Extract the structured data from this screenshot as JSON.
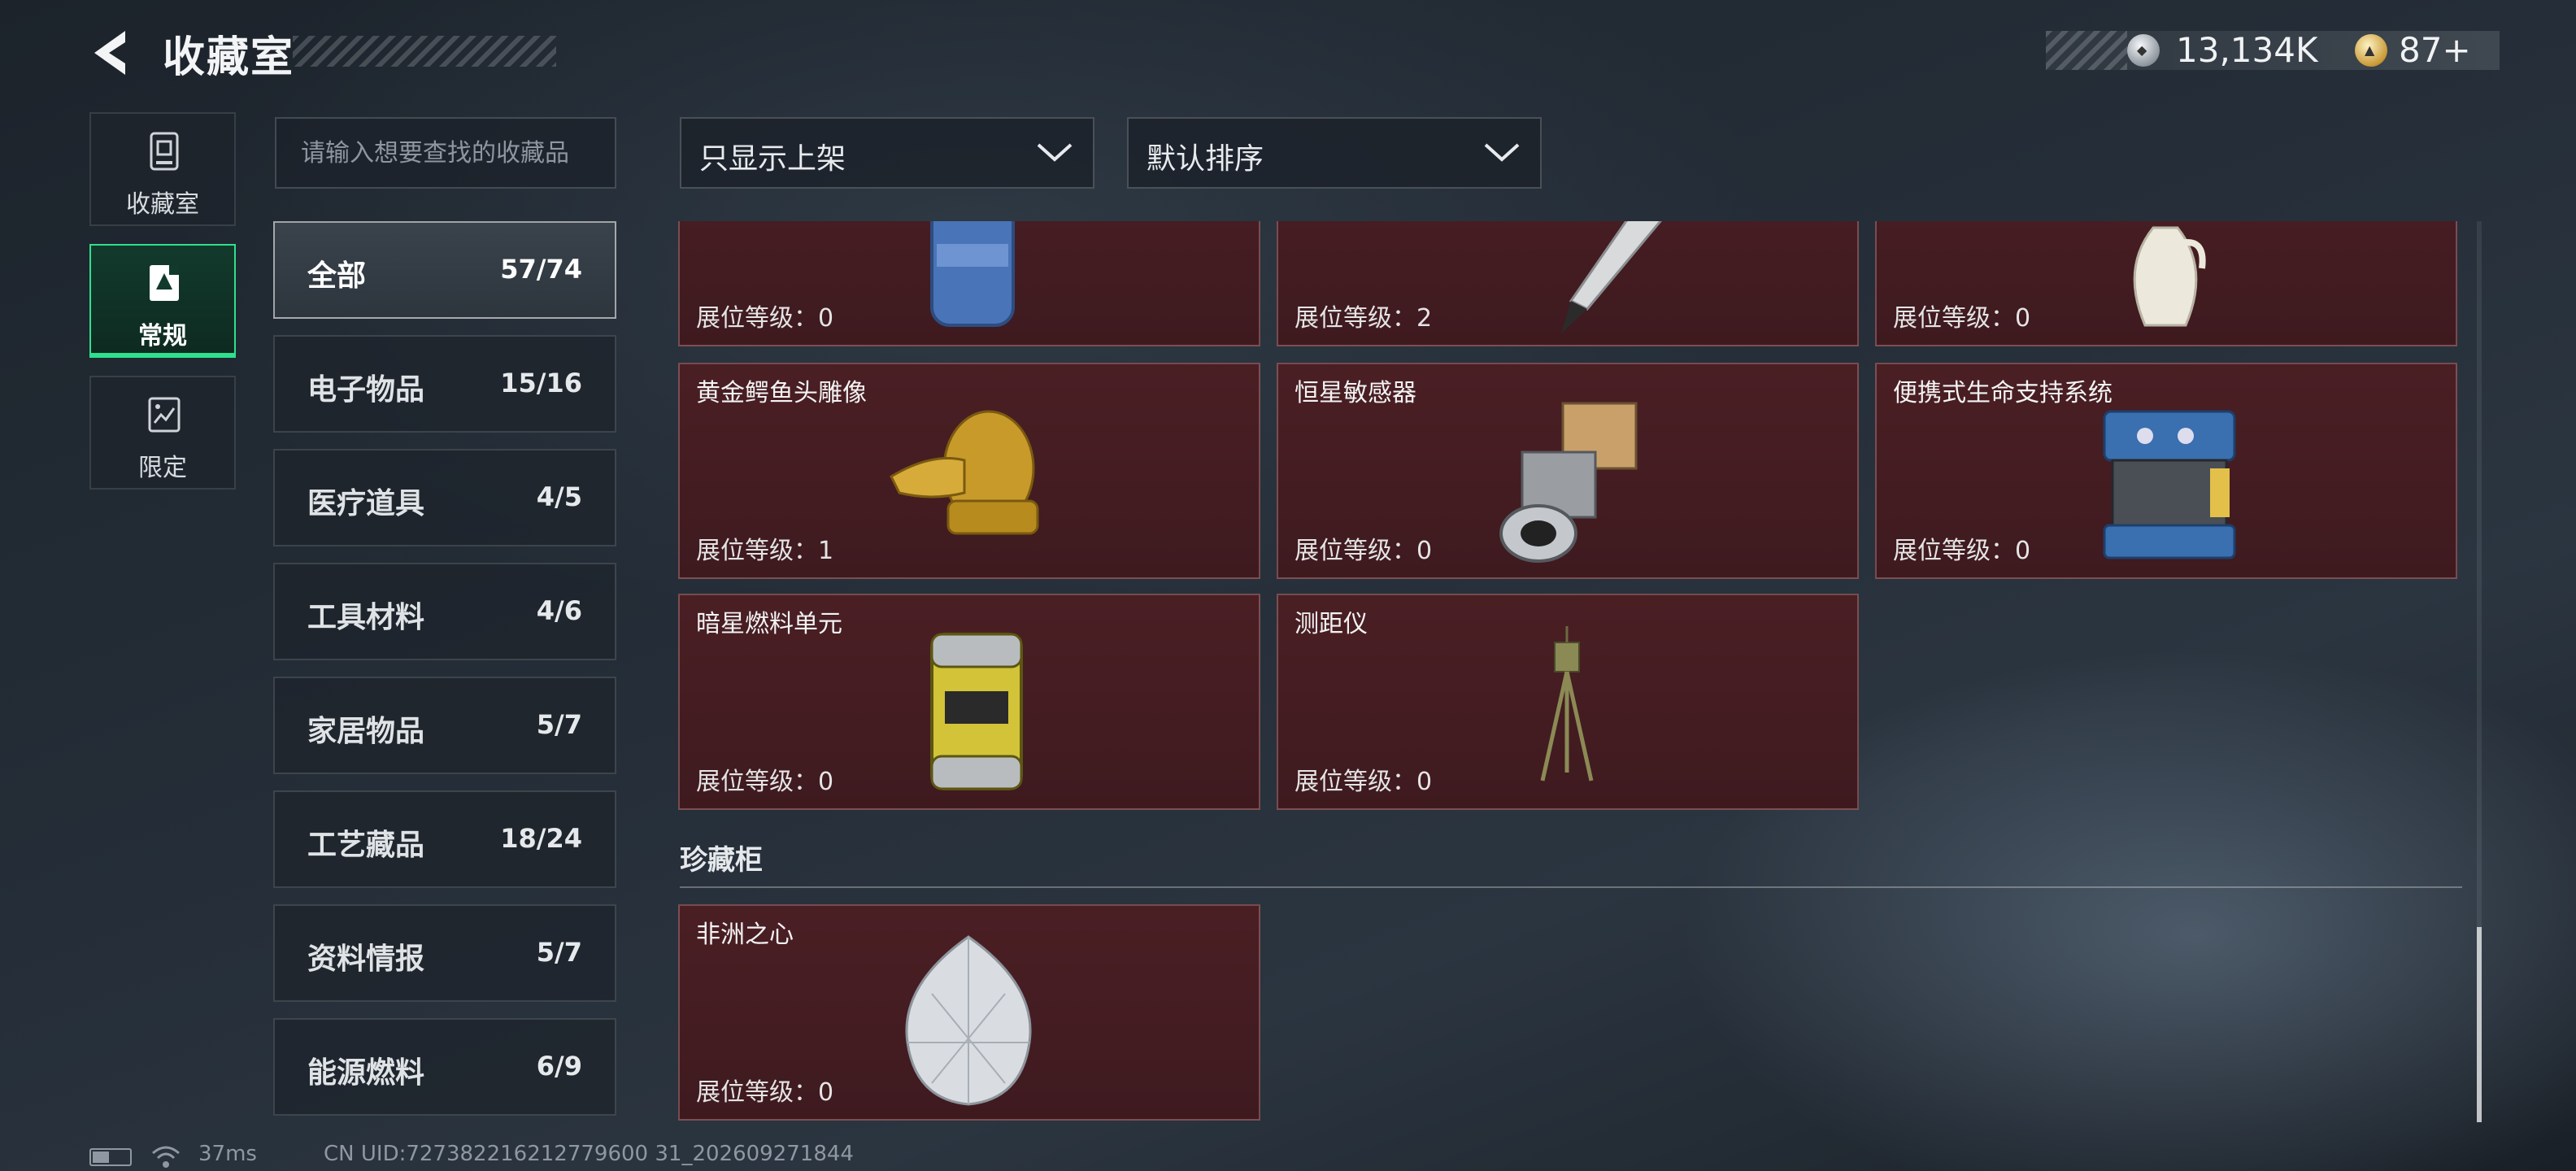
{
  "header": {
    "title": "收藏室"
  },
  "currency": {
    "silver": "13,134K",
    "gold": "87+"
  },
  "side_tabs": [
    {
      "label": "收藏室"
    },
    {
      "label": "常规",
      "active": true
    },
    {
      "label": "限定"
    }
  ],
  "search": {
    "placeholder": "请输入想要查找的收藏品"
  },
  "filters": {
    "display_filter": "只显示上架",
    "sort": "默认排序"
  },
  "categories": [
    {
      "name": "全部",
      "count": "57/74",
      "active": true
    },
    {
      "name": "电子物品",
      "count": "15/16"
    },
    {
      "name": "医疗道具",
      "count": "4/5"
    },
    {
      "name": "工具材料",
      "count": "4/6"
    },
    {
      "name": "家居物品",
      "count": "5/7"
    },
    {
      "name": "工艺藏品",
      "count": "18/24"
    },
    {
      "name": "资料情报",
      "count": "5/7"
    },
    {
      "name": "能源燃料",
      "count": "6/9"
    }
  ],
  "items": [
    {
      "name": "",
      "level": "展位等级：0",
      "icon": "gas-canister"
    },
    {
      "name": "",
      "level": "展位等级：2",
      "icon": "fountain-pen"
    },
    {
      "name": "",
      "level": "展位等级：0",
      "icon": "porcelain-vase"
    },
    {
      "name": "黄金鳄鱼头雕像",
      "level": "展位等级：1",
      "icon": "golden-crocodile-statue"
    },
    {
      "name": "恒星敏感器",
      "level": "展位等级：0",
      "icon": "star-sensor"
    },
    {
      "name": "便携式生命支持系统",
      "level": "展位等级：0",
      "icon": "life-support-pack"
    },
    {
      "name": "暗星燃料单元",
      "level": "展位等级：0",
      "icon": "fuel-cell"
    },
    {
      "name": "测距仪",
      "level": "展位等级：0",
      "icon": "rangefinder-tripod"
    }
  ],
  "vault": {
    "title": "珍藏柜",
    "items": [
      {
        "name": "非洲之心",
        "level": "展位等级：0",
        "icon": "diamond"
      }
    ]
  },
  "status_bar": {
    "ping": "37ms",
    "uid": "CN UID:727382216212779600 31_202609271844",
    "battery_level": 0.45
  }
}
